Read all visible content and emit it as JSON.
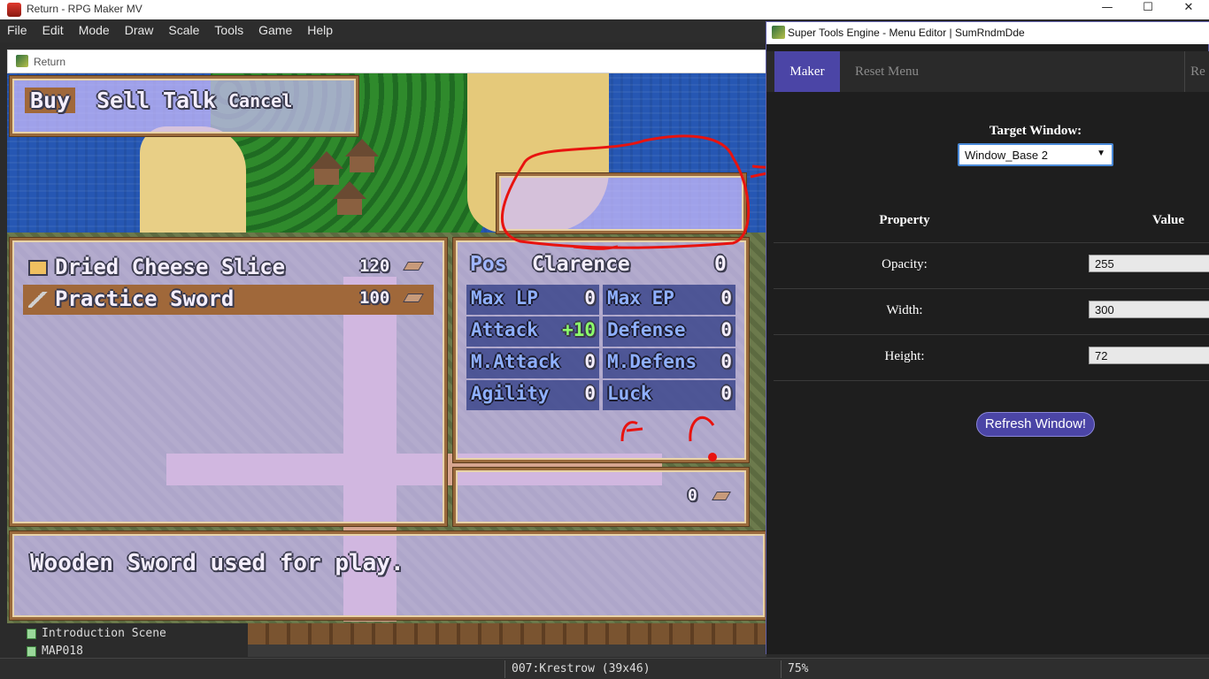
{
  "main_window": {
    "title": "Return - RPG Maker MV",
    "controls": {
      "minimize": "—",
      "maximize": "☐",
      "close": "✕"
    }
  },
  "menu": [
    "File",
    "Edit",
    "Mode",
    "Draw",
    "Scale",
    "Tools",
    "Game",
    "Help"
  ],
  "game_window": {
    "title": "Return"
  },
  "shop": {
    "commands": [
      "Buy",
      "Sell",
      "Talk",
      "Cancel"
    ],
    "selected_command": "Buy",
    "items": [
      {
        "name": "Dried Cheese Slice",
        "price": "120",
        "icon": "cheese-icon"
      },
      {
        "name": "Practice Sword",
        "price": "100",
        "icon": "sword-icon"
      }
    ],
    "status": {
      "header_left": "Pos",
      "actor": "Clarence",
      "possession": "0",
      "stats": [
        {
          "label": "Max LP",
          "value": "0"
        },
        {
          "label": "Max EP",
          "value": "0"
        },
        {
          "label": "Attack",
          "value": "+10"
        },
        {
          "label": "Defense",
          "value": "0"
        },
        {
          "label": "M.Attack",
          "value": "0"
        },
        {
          "label": "M.Defens",
          "value": "0"
        },
        {
          "label": "Agility",
          "value": "0"
        },
        {
          "label": "Luck",
          "value": "0"
        }
      ]
    },
    "gold": "0",
    "help_text": "Wooden Sword used for play."
  },
  "map_tree": [
    "Introduction Scene",
    "MAP018"
  ],
  "statusbar": {
    "map": "007:Krestrow (39x46)",
    "zoom": "75%"
  },
  "ste": {
    "title": "Super Tools Engine  -  Menu Editor  |  SumRndmDde",
    "tabs": [
      "Maker",
      "Reset Menu",
      "Re"
    ],
    "active_tab": "Maker",
    "target_label": "Target Window:",
    "target_value": "Window_Base 2",
    "property_header": "Property",
    "value_header": "Value",
    "properties": [
      {
        "label": "Opacity:",
        "value": "255"
      },
      {
        "label": "Width:",
        "value": "300"
      },
      {
        "label": "Height:",
        "value": "72"
      }
    ],
    "refresh_button": "Refresh Window!"
  },
  "annotation_color": "#e8130f"
}
